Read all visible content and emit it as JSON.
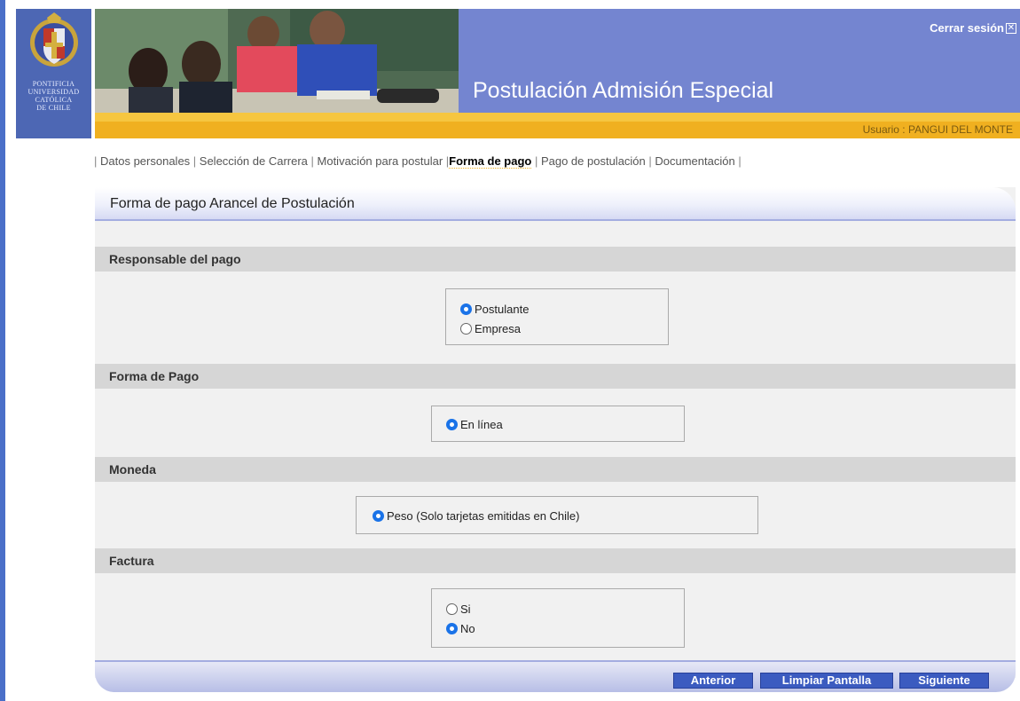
{
  "header": {
    "crest_text": [
      "PONTIFICIA",
      "UNIVERSIDAD",
      "CATÓLICA",
      "DE CHILE"
    ],
    "logout_label": "Cerrar sesión",
    "app_title": "Postulación Admisión Especial",
    "user_label": "Usuario : PANGUI DEL MONTE"
  },
  "nav": {
    "items": [
      {
        "label": "Datos personales"
      },
      {
        "label": "Selección de Carrera"
      },
      {
        "label": "Motivación para postular"
      },
      {
        "label": "Forma de pago",
        "active": true
      },
      {
        "label": "Pago de postulación"
      },
      {
        "label": "Documentación"
      }
    ]
  },
  "panel": {
    "title": "Forma de pago Arancel de Postulación",
    "sections": {
      "responsable": {
        "title": "Responsable del pago",
        "options": [
          {
            "label": "Postulante",
            "selected": true
          },
          {
            "label": "Empresa",
            "selected": false
          }
        ]
      },
      "forma_pago": {
        "title": "Forma de Pago",
        "options": [
          {
            "label": "En línea",
            "selected": true
          }
        ]
      },
      "moneda": {
        "title": "Moneda",
        "options": [
          {
            "label": "Peso (Solo tarjetas emitidas en Chile)",
            "selected": true
          }
        ]
      },
      "factura": {
        "title": "Factura",
        "options": [
          {
            "label": "Si",
            "selected": false
          },
          {
            "label": "No",
            "selected": true
          }
        ]
      }
    },
    "buttons": {
      "anterior": "Anterior",
      "limpiar": "Limpiar Pantalla",
      "siguiente": "Siguiente"
    }
  },
  "colors": {
    "banner_blue": "#7485d0",
    "crest_blue": "#4d67b4",
    "gold": "#f0b020",
    "button_blue": "#3b5bc0",
    "radio_selected": "#1a73e8"
  }
}
